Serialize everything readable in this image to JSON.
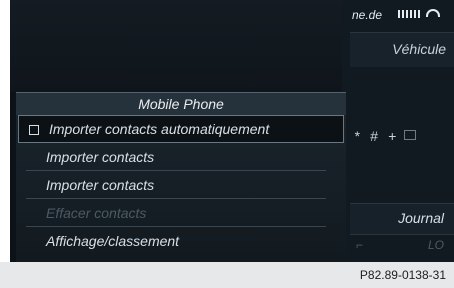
{
  "status": {
    "carrier_text": "ne.de"
  },
  "tabs": {
    "vehicle": "Véhicule",
    "journal": "Journal"
  },
  "keypad": {
    "star": "*",
    "hash": "#",
    "plus": "+"
  },
  "menu": {
    "title": "Mobile Phone",
    "items": [
      {
        "label": "Importer contacts automatiquement",
        "checkbox": true,
        "enabled": true
      },
      {
        "label": "Importer contacts",
        "enabled": true
      },
      {
        "label": "Importer contacts",
        "enabled": true
      },
      {
        "label": "Effacer contacts",
        "enabled": false
      },
      {
        "label": "Affichage/classement",
        "enabled": true
      }
    ]
  },
  "footer": {
    "code": "P82.89-0138-31"
  },
  "colors": {
    "background": "#0d1218",
    "menu_bg": "#1b252d",
    "text": "#d7e0e6",
    "disabled_text": "#4d5962"
  }
}
